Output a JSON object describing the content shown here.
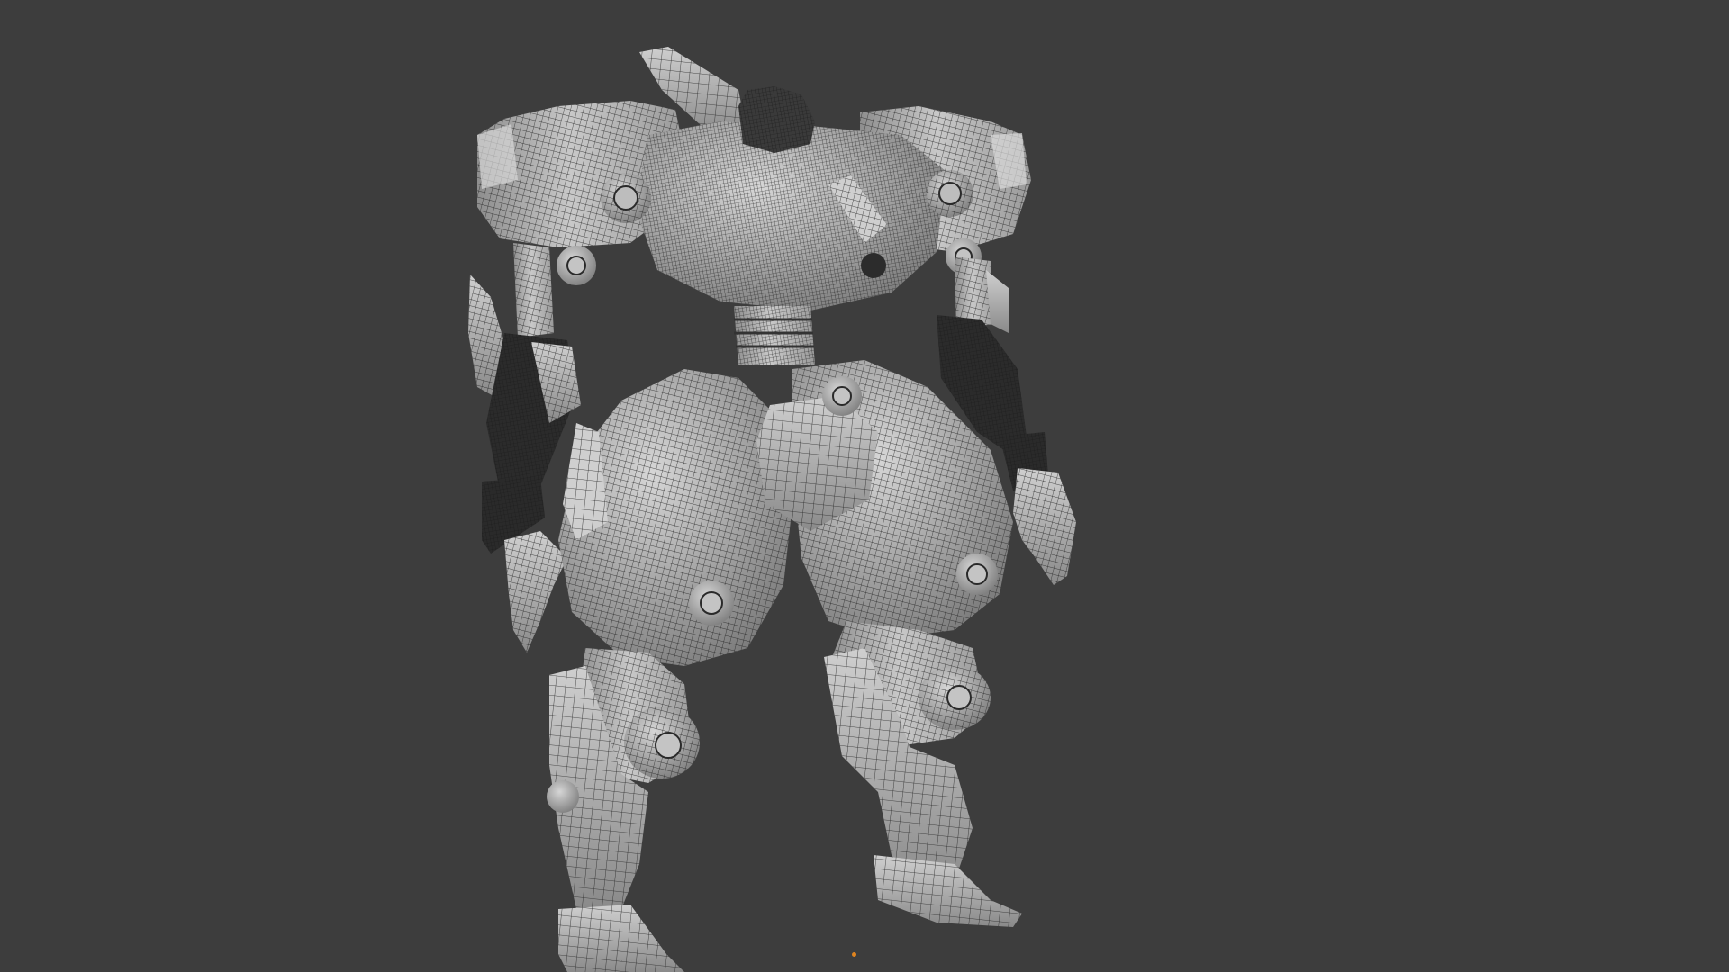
{
  "viewport": {
    "background": "#3d3d3d",
    "shading": "solid",
    "overlay": "wireframe",
    "mesh_color": "#b9b9b9",
    "wire_color": "#1e1e1e",
    "dark_part_color": "#2a2a2a"
  },
  "model": {
    "subject": "mech-robot",
    "parts": [
      "head",
      "back-fin",
      "chest",
      "shoulder-left",
      "shoulder-right",
      "waist",
      "arm-left",
      "arm-right",
      "forearm-left",
      "forearm-right",
      "hand-left",
      "hand-right",
      "hip-left",
      "hip-right",
      "crotch-plate",
      "thigh-left",
      "thigh-right",
      "knee-left",
      "knee-right",
      "shin-left",
      "shin-right",
      "foot-left",
      "foot-right"
    ]
  },
  "origin_marker": {
    "color": "#e0841f"
  }
}
